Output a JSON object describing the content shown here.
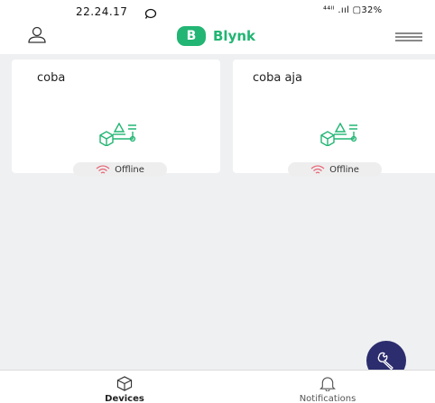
{
  "status_bar": {
    "time": "22.24.17",
    "right_indicators": "⁴⁴ᴵᴵ .ııl ▢32%"
  },
  "header": {
    "brand_badge": "B",
    "brand_name": "Blynk"
  },
  "devices": [
    {
      "name": "coba",
      "status": "Offline"
    },
    {
      "name": "coba aja",
      "status": "Offline"
    }
  ],
  "bottom_nav": {
    "devices_label": "Devices",
    "notifications_label": "Notifications"
  },
  "colors": {
    "brand": "#22b573",
    "fab": "#2c2d6e",
    "offline": "#e8697a",
    "background": "#eff0f2"
  },
  "icons": [
    "ring-icon",
    "user-icon",
    "menu-icon",
    "device-icon",
    "offline-wifi-icon",
    "wrench-icon",
    "devices-cube-icon",
    "bell-icon"
  ]
}
